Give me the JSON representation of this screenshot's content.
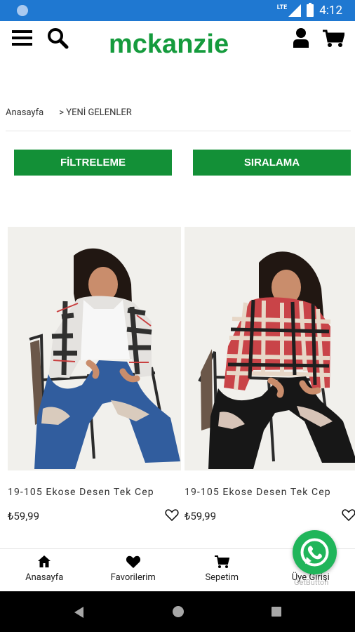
{
  "status": {
    "network": "LTE",
    "time": "4:12"
  },
  "header": {
    "brand": "mckanzie"
  },
  "breadcrumb": {
    "home": "Anasayfa",
    "current": "> YENİ GELENLER"
  },
  "actions": {
    "filter": "FİLTRELEME",
    "sort": "SIRALAMA"
  },
  "products": [
    {
      "name": "19-105 Ekose Desen Tek Cep",
      "price": "₺59,99",
      "shirt_color": "#e5e5e5",
      "pants_color": "#315d9e"
    },
    {
      "name": "19-105 Ekose Desen Tek Cep",
      "price": "₺59,99",
      "shirt_color": "#c94448",
      "pants_color": "#171717"
    }
  ],
  "bottom_nav": [
    "Anasayfa",
    "Favorilerim",
    "Sepetim",
    "Üye Girişi"
  ],
  "whatsapp": {
    "provider": "GetButton"
  }
}
